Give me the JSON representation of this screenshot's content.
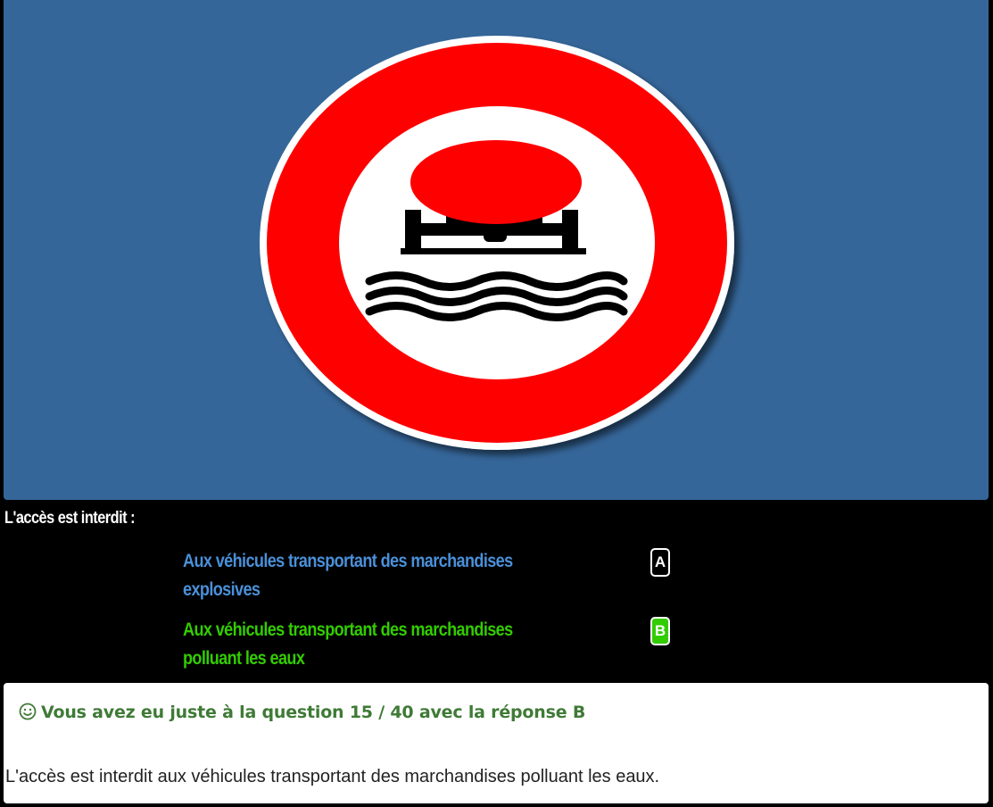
{
  "sign": {
    "icon": "prohibited-polluting-goods-sign",
    "colors": {
      "background": "#356699",
      "ring": "#ff0000",
      "inner": "#ffffff",
      "symbol": "#000000"
    }
  },
  "question": {
    "text": "L'accès est interdit :"
  },
  "answers": [
    {
      "letter": "A",
      "text": "Aux véhicules transportant des marchandises explosives",
      "color": "#4a90d9",
      "selected": false
    },
    {
      "letter": "B",
      "text": "Aux véhicules transportant des marchandises polluant les eaux",
      "color": "#33cc00",
      "selected": true
    }
  ],
  "result": {
    "icon": "smile-icon",
    "title": "Vous avez eu juste à la question 15 / 40 avec la réponse B",
    "explanation": "L'accès est interdit aux véhicules transportant des marchandises polluant les eaux."
  }
}
